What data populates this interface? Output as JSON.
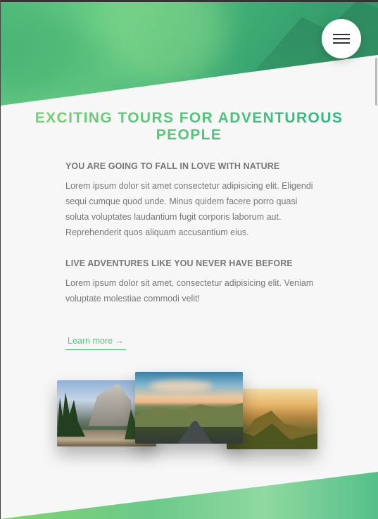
{
  "header": {
    "menu_icon": "hamburger-menu-icon"
  },
  "main": {
    "title": "EXCITING TOURS FOR ADVENTUROUS PEOPLE",
    "sections": [
      {
        "heading": "YOU ARE GOING TO FALL IN LOVE WITH NATURE",
        "text": "Lorem ipsum dolor sit amet consectetur adipisicing elit. Eligendi sequi cumque quod unde. Minus quidem facere porro quasi soluta voluptates laudantium fugit corporis laborum aut. Reprehenderit quos aliquam accusantium eius."
      },
      {
        "heading": "LIVE ADVENTURES LIKE YOU NEVER HAVE BEFORE",
        "text": "Lorem ipsum dolor sit amet, consectetur adipisicing elit. Veniam voluptate molestiae commodi velit!"
      }
    ],
    "link_label": "Learn more →"
  },
  "colors": {
    "accent": "#55c57a",
    "accent_dark": "#28b485",
    "background": "#f7f7f7",
    "text": "#777777"
  }
}
